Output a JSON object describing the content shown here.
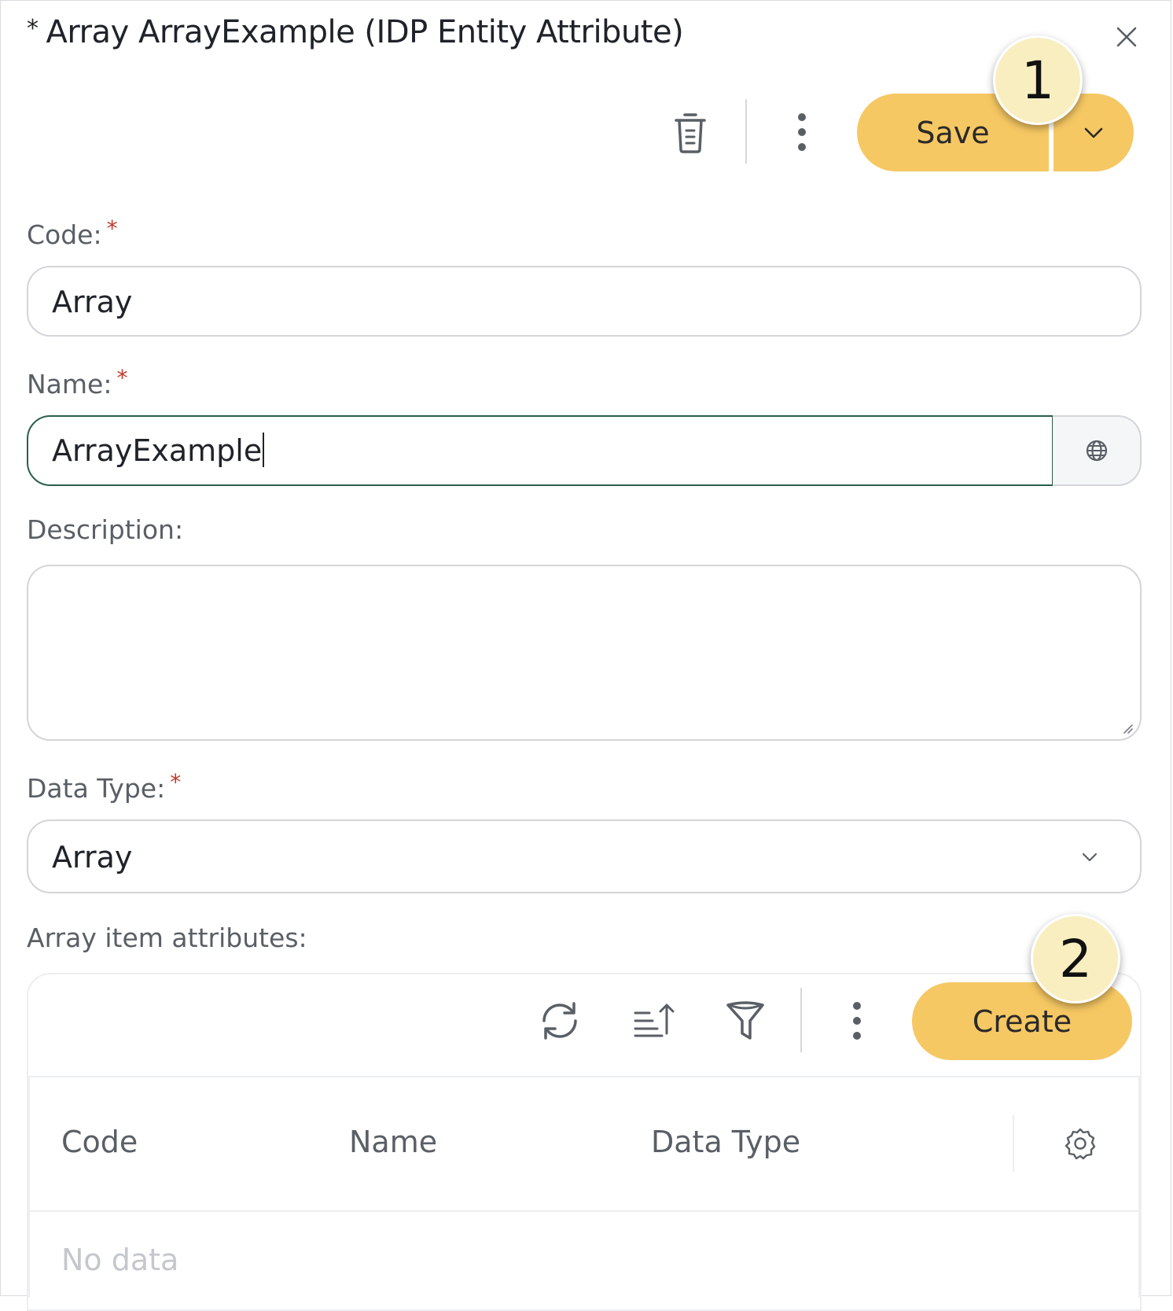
{
  "dialog": {
    "title_marker": "*",
    "title": "Array ArrayExample (IDP Entity Attribute)"
  },
  "toolbar": {
    "save_label": "Save"
  },
  "badges": {
    "one": "1",
    "two": "2"
  },
  "form": {
    "code_label": "Code:",
    "code_value": "Array",
    "name_label": "Name:",
    "name_value": "ArrayExample",
    "description_label": "Description:",
    "description_value": "",
    "data_type_label": "Data Type:",
    "data_type_value": "Array",
    "required_marker": "*"
  },
  "array_items": {
    "label": "Array item attributes:",
    "create_label": "Create",
    "columns": [
      "Code",
      "Name",
      "Data Type"
    ],
    "empty_text": "No data"
  },
  "colors": {
    "accent": "#f6c863",
    "focus_border": "#2b5f4a",
    "required": "#c0392b"
  }
}
